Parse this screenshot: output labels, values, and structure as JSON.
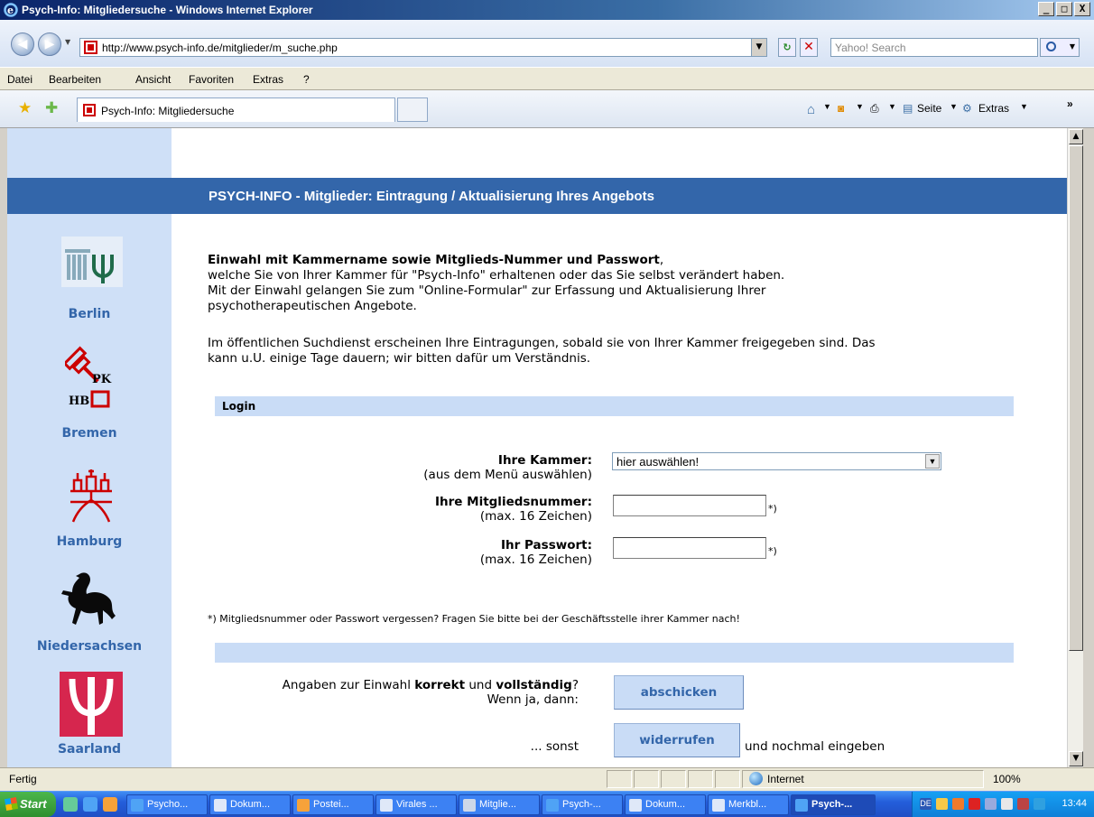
{
  "window": {
    "title": "Psych-Info: Mitgliedersuche - Windows Internet Explorer",
    "buttons": {
      "minimize": "_",
      "maximize": "□",
      "close": "X"
    }
  },
  "address_bar": {
    "url": "http://www.psych-info.de/mitglieder/m_suche.php",
    "search_placeholder": "Yahoo! Search"
  },
  "menu": [
    "Datei",
    "Bearbeiten",
    "Ansicht",
    "Favoriten",
    "Extras",
    "?"
  ],
  "tab": {
    "title": "Psych-Info: Mitgliedersuche"
  },
  "command_bar": {
    "page_label": "Seite",
    "tools_label": "Extras",
    "more": "»"
  },
  "page": {
    "banner": "PSYCH-INFO - Mitglieder: Eintragung / Aktualisierung Ihres Angebots",
    "intro": {
      "headline": "Einwahl mit Kammername sowie Mitglieds-Nummer und Passwort",
      "headline_suffix": ",",
      "line2": "welche Sie von Ihrer Kammer für \"Psych-Info\" erhaltenen oder das Sie selbst verändert haben.",
      "line3": "Mit der Einwahl gelangen Sie zum \"Online-Formular\" zur Erfassung und Aktualisierung Ihrer",
      "line4": "psychotherapeutischen Angebote.",
      "para2_line1": "Im öffentlichen Suchdienst erscheinen Ihre Eintragungen, sobald sie von Ihrer Kammer freigegeben sind. Das",
      "para2_line2": "kann u.U. einige Tage dauern; wir bitten dafür um Verständnis."
    },
    "login_section": "Login",
    "form": {
      "kammer_label": "Ihre Kammer:",
      "kammer_hint": "(aus dem Menü auswählen)",
      "kammer_value": "hier auswählen!",
      "member_label": "Ihre Mitgliedsnummer:",
      "member_hint": "(max. 16 Zeichen)",
      "password_label": "Ihr Passwort:",
      "password_hint": "(max. 16 Zeichen)",
      "asterisk": "*)"
    },
    "note": "*) Mitgliedsnummer oder Passwort vergessen? Fragen Sie bitte bei der Geschäftsstelle ihrer Kammer nach!",
    "confirm": {
      "q_prefix": "Angaben zur Einwahl ",
      "q_b1": "korrekt",
      "q_mid": " und ",
      "q_b2": "vollständig",
      "q_suffix": "?",
      "then": "Wenn ja, dann:",
      "submit": "abschicken",
      "else": "... sonst",
      "reset": "widerrufen",
      "reset_suffix": "und nochmal eingeben"
    },
    "sidebar": [
      {
        "name": "Berlin",
        "icon": "berlin-chamber-logo"
      },
      {
        "name": "Bremen",
        "icon": "bremen-chamber-logo"
      },
      {
        "name": "Hamburg",
        "icon": "hamburg-chamber-logo"
      },
      {
        "name": "Niedersachsen",
        "icon": "niedersachsen-horse-logo"
      },
      {
        "name": "Saarland",
        "icon": "saarland-psi-logo"
      }
    ],
    "bremen_logo_text": {
      "pk": "PK",
      "hb": "HB"
    }
  },
  "status_bar": {
    "text": "Fertig",
    "zone": "Internet",
    "zoom": "100%"
  },
  "taskbar": {
    "start": "Start",
    "tasks": [
      "Psycho...",
      "Dokum...",
      "Postei...",
      "Virales ...",
      "Mitglie...",
      "Psych-...",
      "Dokum...",
      "Merkbl...",
      "Psych-..."
    ],
    "clock": "13:44",
    "tray_lang": "DE"
  },
  "colors": {
    "accent": "#3366aa",
    "sidebar_bg": "#cfe0f7",
    "section_bg": "#c9dcf6"
  }
}
